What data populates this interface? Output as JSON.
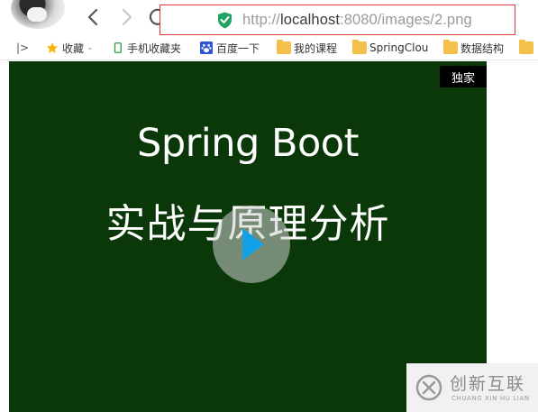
{
  "browser": {
    "address_bar": {
      "url_prefix": "http://",
      "url_host": "localhost",
      "url_path": ":8080/images/2.png"
    },
    "icons": {
      "back": "chevron-left-icon",
      "forward": "chevron-right-icon",
      "reload": "reload-icon",
      "home": "home-icon",
      "security": "shield-icon"
    },
    "accent_color": "#d93a3a"
  },
  "bookmarks": {
    "items": [
      {
        "label": "收藏",
        "icon": "star-icon"
      },
      {
        "label": "手机收藏夹",
        "icon": "phone-icon"
      },
      {
        "label": "百度一下",
        "icon": "baidu-paw-icon"
      },
      {
        "label": "我的课程",
        "icon": "folder-icon"
      },
      {
        "label": "SpringClou",
        "icon": "folder-icon"
      },
      {
        "label": "数据结构",
        "icon": "folder-icon"
      }
    ]
  },
  "content": {
    "badge": "独家",
    "title_en": "Spring Boot",
    "title_cn": "实战与原理分析",
    "background_color": "#0a3809"
  },
  "watermark": {
    "text_cn": "创新互联",
    "text_en": "CHUANG XIN HU LIAN"
  }
}
